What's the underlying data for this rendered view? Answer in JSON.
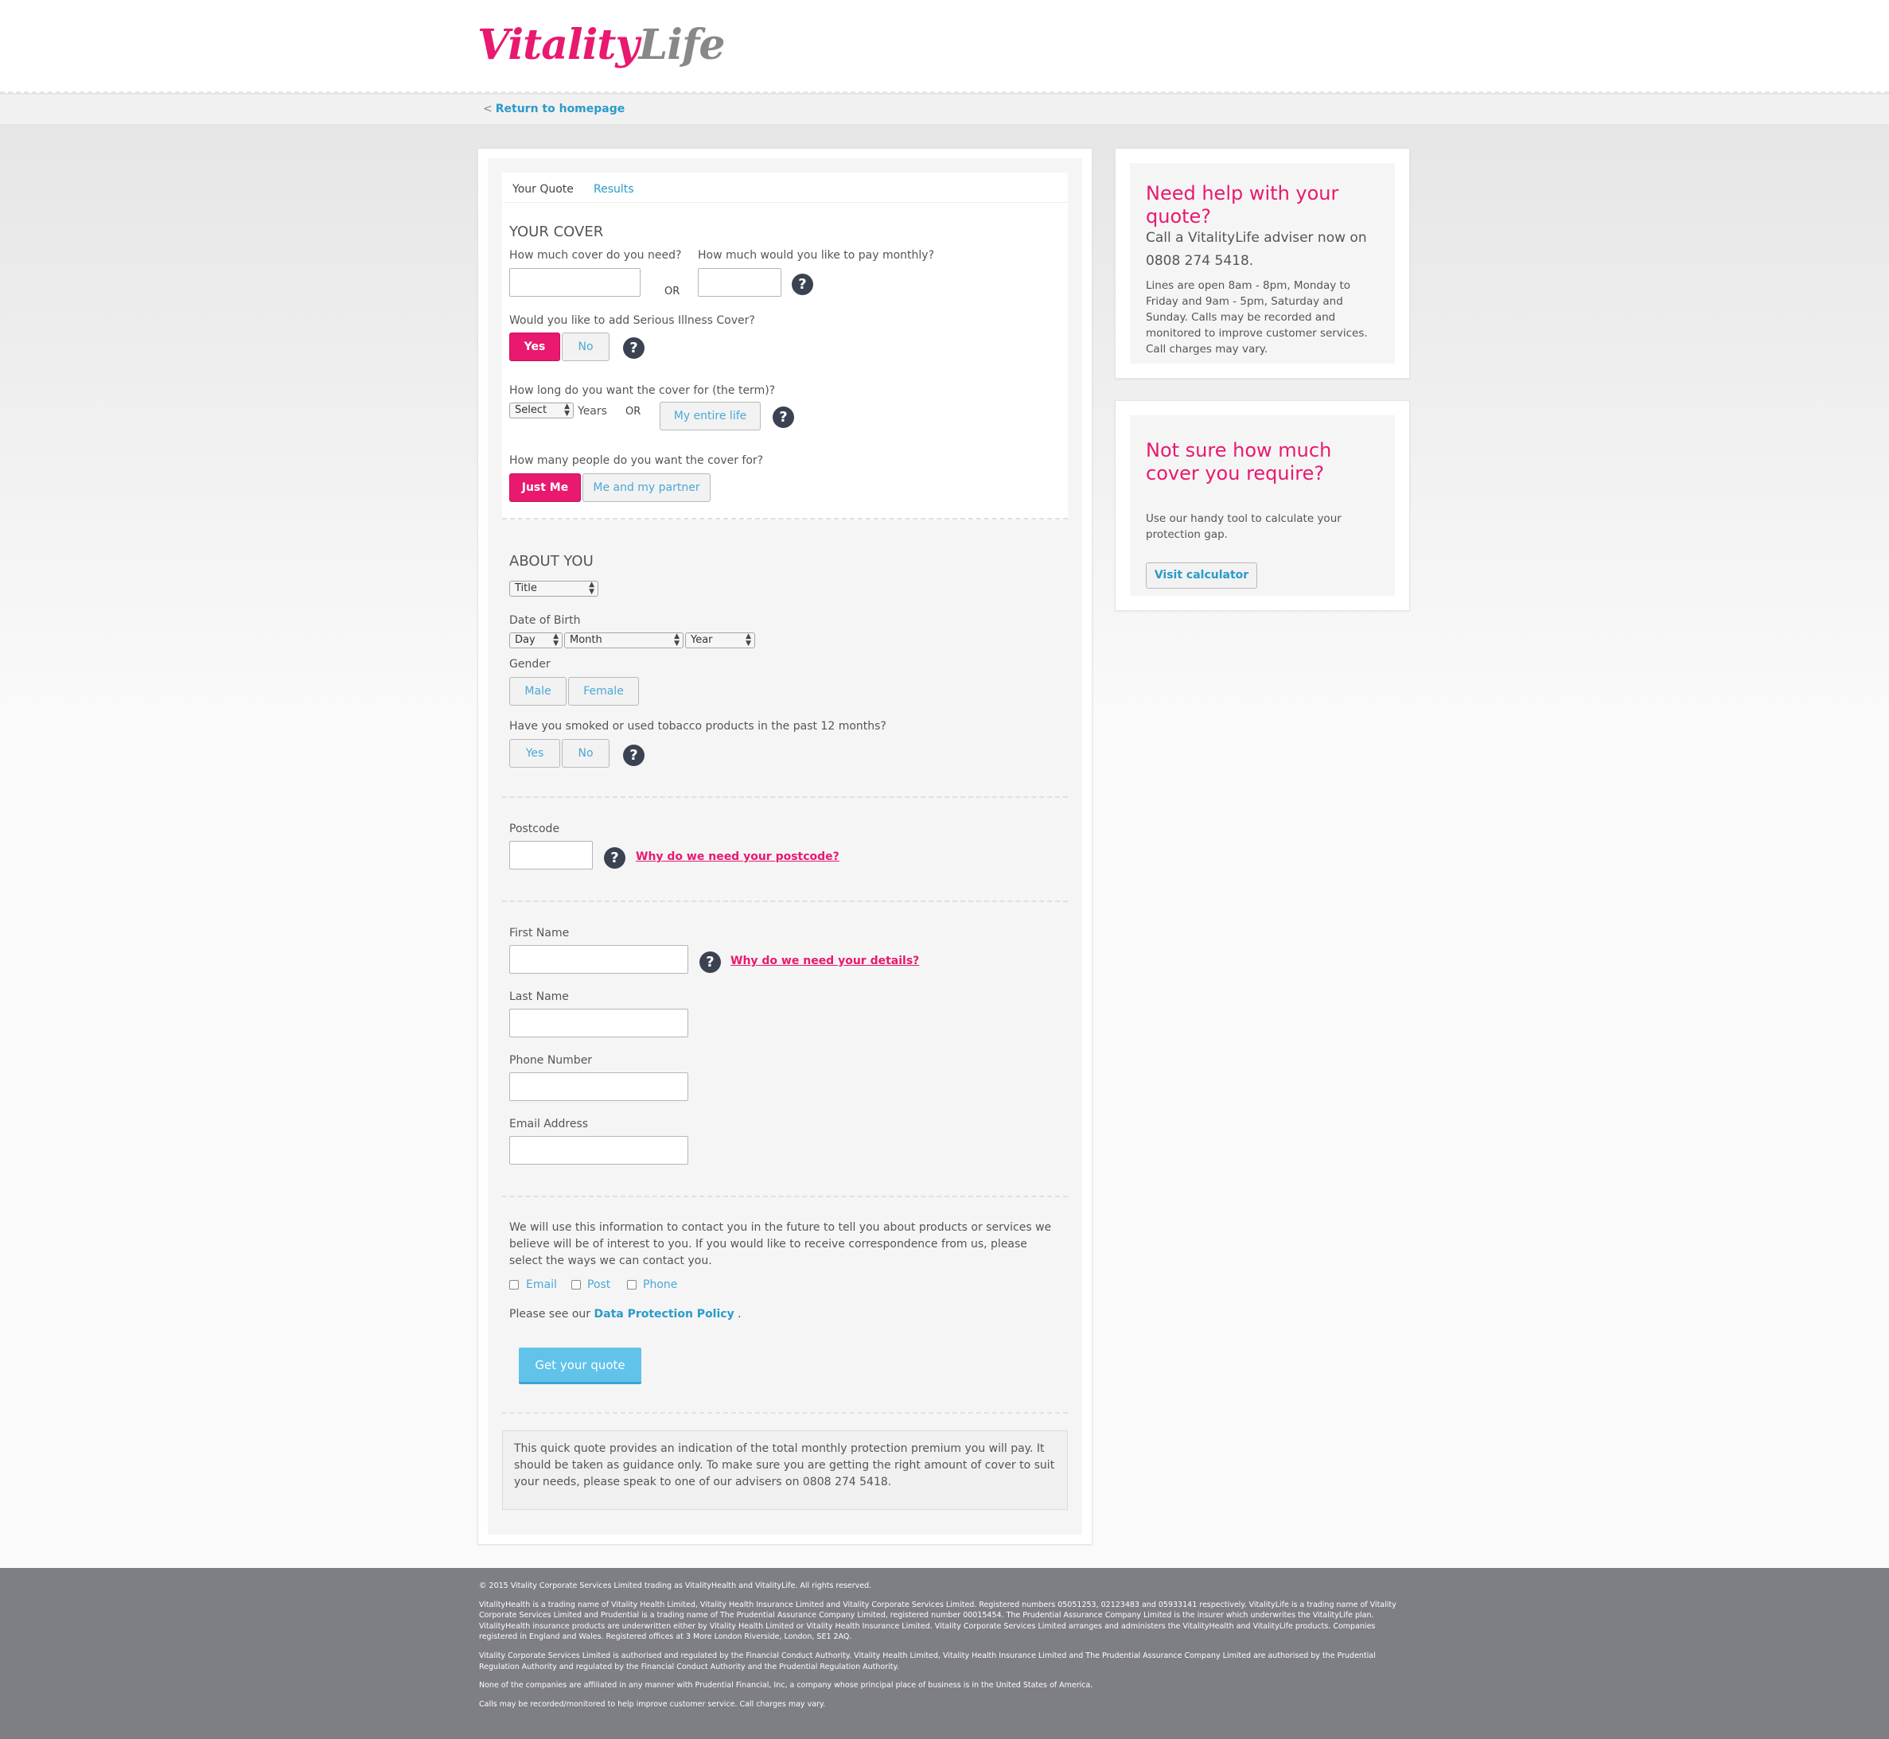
{
  "brand": {
    "logo_part1": "Vitality",
    "logo_part2": "Life"
  },
  "nav": {
    "back_label": "Return to homepage"
  },
  "tabs": {
    "quote": "Your Quote",
    "results": "Results"
  },
  "cover": {
    "title": "YOUR COVER",
    "cover_amount_label": "How much cover do you need?",
    "or": "OR",
    "monthly_label": "How much would you like to pay monthly?",
    "serious_illness_label": "Would you like to add Serious Illness Cover?",
    "yes": "Yes",
    "no": "No",
    "term_label": "How long do you want the cover for (the term)?",
    "term_select": "Select",
    "years": "Years",
    "entire_life": "My entire life",
    "people_label": "How many people do you want the cover for?",
    "just_me": "Just Me",
    "me_partner": "Me and my partner"
  },
  "about": {
    "title": "ABOUT YOU",
    "title_select": "Title",
    "dob_label": "Date of Birth",
    "day": "Day",
    "month": "Month",
    "year": "Year",
    "gender_label": "Gender",
    "male": "Male",
    "female": "Female",
    "smoker_label": "Have you smoked or used tobacco products in the past 12 months?",
    "yes": "Yes",
    "no": "No"
  },
  "postcode": {
    "label": "Postcode",
    "why_link": "Why do we need your postcode?"
  },
  "details": {
    "first_name": "First Name",
    "why_link": "Why do we need your details?",
    "last_name": "Last Name",
    "phone": "Phone Number",
    "email": "Email Address"
  },
  "consent": {
    "text": "We will use this information to contact you in the future to tell you about products or services we believe will be of interest to you. If you would like to receive correspondence from us, please select the ways we can contact you.",
    "email": "Email",
    "post": "Post",
    "phone": "Phone",
    "policy_prefix": "Please see our",
    "policy_link": "Data Protection Policy",
    "policy_suffix": ".",
    "submit": "Get your quote"
  },
  "disclaimer": "This quick quote provides an indication of the total monthly protection premium you will pay. It should be taken as guidance only. To make sure you are getting the right amount of cover to suit your needs, please speak to one of our advisers on 0808 274 5418.",
  "help_card": {
    "title": "Need help with your quote?",
    "call_text": "Call a VitalityLife adviser now on 0808 274 5418.",
    "hours_text": "Lines are open 8am - 8pm, Monday to Friday and 9am - 5pm, Saturday and Sunday. Calls may be recorded and monitored to improve customer services. Call charges may vary."
  },
  "calc_card": {
    "title": "Not sure how much cover you require?",
    "text": "Use our handy tool to calculate your protection gap.",
    "button": "Visit calculator"
  },
  "footer": {
    "p1": "© 2015 Vitality Corporate Services Limited trading as VitalityHealth and VitalityLife. All rights reserved.",
    "p2": "VitalityHealth is a trading name of Vitality Health Limited, Vitality Health Insurance Limited and Vitality Corporate Services Limited. Registered numbers 05051253, 02123483 and 05933141 respectively. VitalityLife is a trading name of Vitality Corporate Services Limited and Prudential is a trading name of The Prudential Assurance Company Limited, registered number 00015454. The Prudential Assurance Company Limited is the insurer which underwrites the VitalityLife plan. VitalityHealth insurance products are underwritten either by Vitality Health Limited or Vitality Health Insurance Limited. Vitality Corporate Services Limited arranges and administers the VitalityHealth and VitalityLife products. Companies registered in England and Wales. Registered offices at 3 More London Riverside, London, SE1 2AQ.",
    "p3": "Vitality Corporate Services Limited is authorised and regulated by the Financial Conduct Authority. Vitality Health Limited, Vitality Health Insurance Limited and The Prudential Assurance Company Limited are authorised by the Prudential Regulation Authority and regulated by the Financial Conduct Authority and the Prudential Regulation Authority.",
    "p4": "None of the companies are affiliated in any manner with Prudential Financial, Inc, a company whose principal place of business is in the United States of America.",
    "p5": "Calls may be recorded/monitored to help improve customer service. Call charges may vary."
  },
  "colors": {
    "brand_pink": "#e8196f",
    "link_blue": "#2a9bc9",
    "button_blue": "#61c3ea",
    "footer_grey": "#7e7e85"
  }
}
